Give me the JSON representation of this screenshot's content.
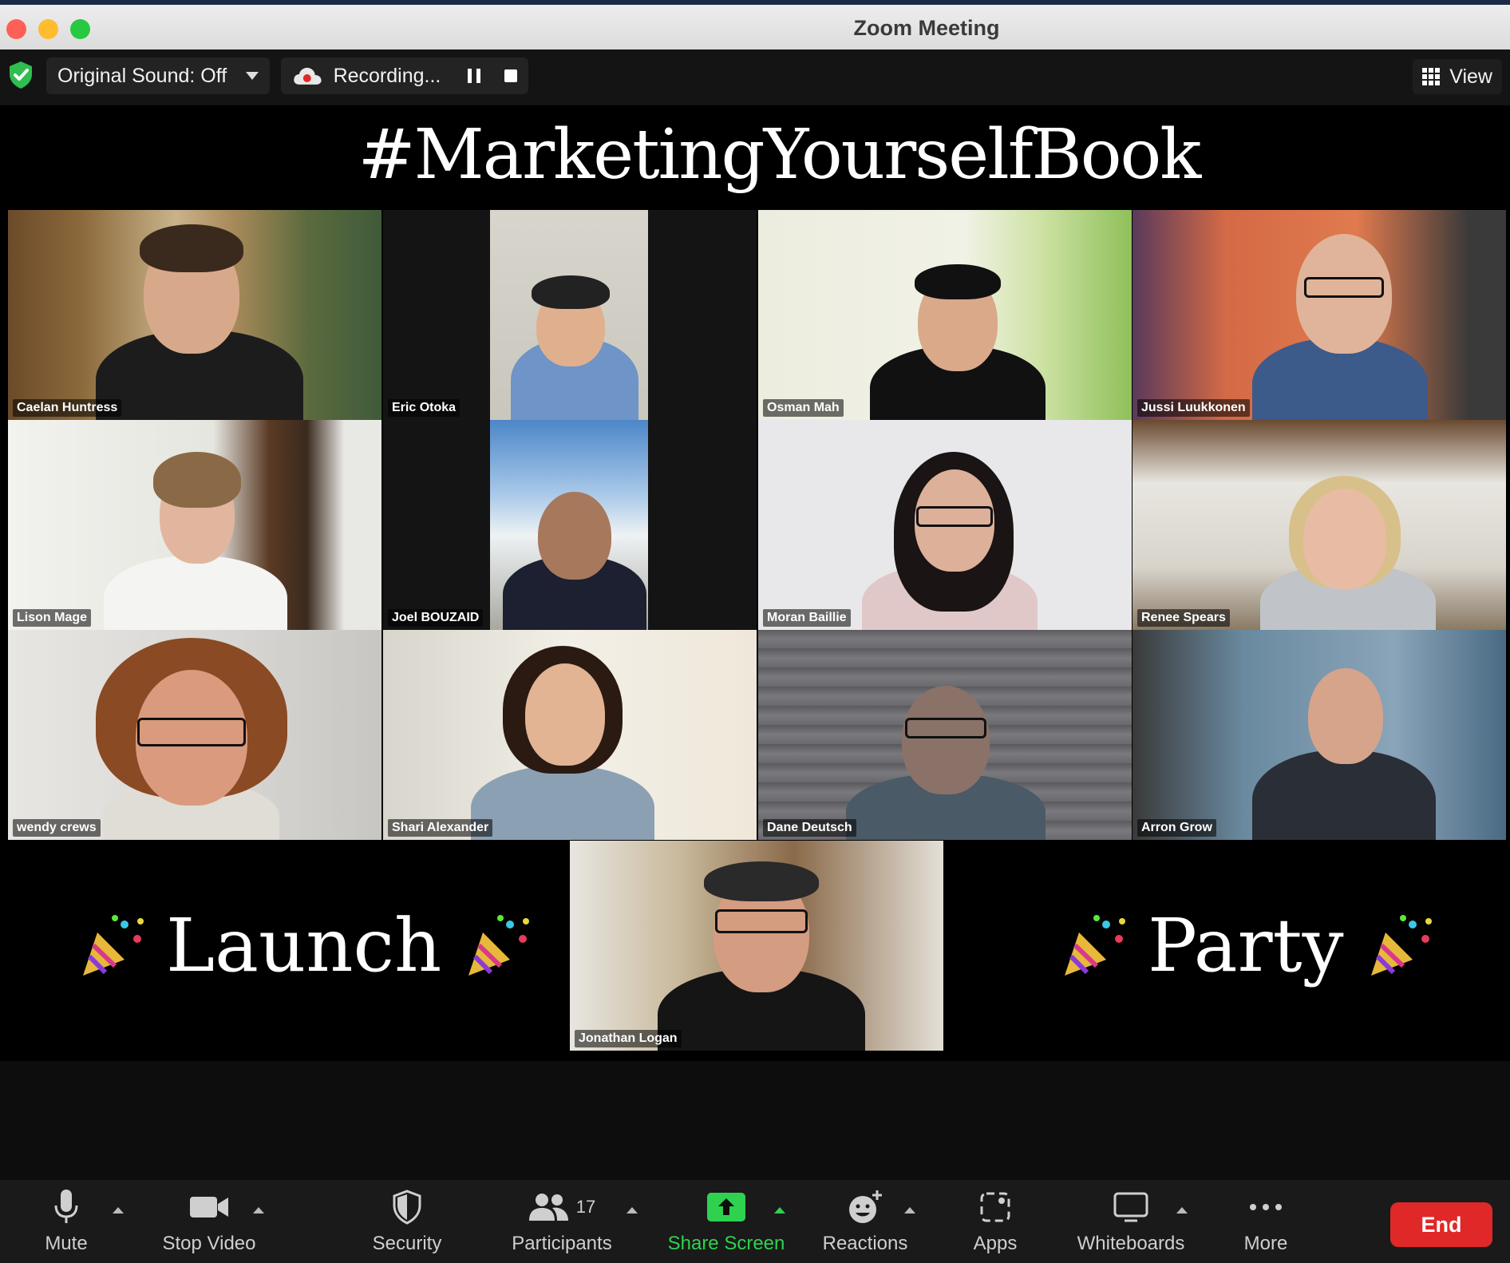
{
  "window": {
    "title": "Zoom Meeting"
  },
  "topbar": {
    "sound_label": "Original Sound: Off",
    "recording_label": "Recording...",
    "view_label": "View"
  },
  "banner": {
    "text": "#MarketingYourselfBook"
  },
  "gallery": {
    "participants": [
      {
        "name": "Caelan Huntress"
      },
      {
        "name": "Eric Otoka"
      },
      {
        "name": "Osman Mah"
      },
      {
        "name": "Jussi Luukkonen"
      },
      {
        "name": "Lison Mage"
      },
      {
        "name": "Joel BOUZAID"
      },
      {
        "name": "Moran Baillie"
      },
      {
        "name": "Renee Spears"
      },
      {
        "name": "wendy crews"
      },
      {
        "name": "Shari Alexander"
      },
      {
        "name": "Dane Deutsch"
      },
      {
        "name": "Arron Grow"
      },
      {
        "name": "Jonathan Logan"
      }
    ],
    "left_word": "Launch",
    "right_word": "Party"
  },
  "toolbar": {
    "mute": "Mute",
    "stop_video": "Stop Video",
    "security": "Security",
    "participants": "Participants",
    "participant_count": "17",
    "share_screen": "Share Screen",
    "reactions": "Reactions",
    "apps": "Apps",
    "whiteboards": "Whiteboards",
    "more": "More",
    "end": "End"
  },
  "colors": {
    "accent_green": "#2fd24f",
    "end_red": "#e02828",
    "background": "#0d0d0d"
  }
}
